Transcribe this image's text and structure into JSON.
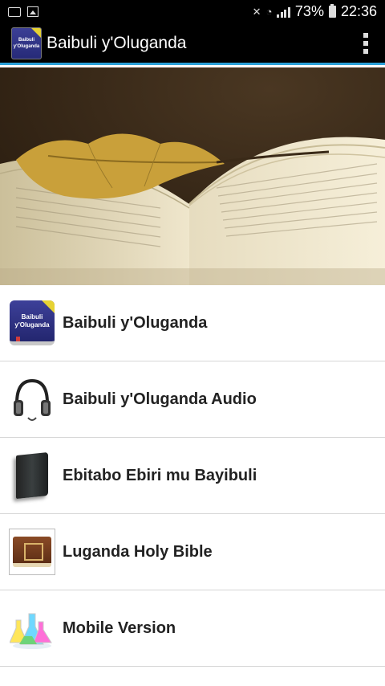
{
  "status_bar": {
    "left_icons": [
      "photo-notification-icon",
      "image-notification-icon"
    ],
    "right_icons": [
      "mute-icon",
      "wifi-icon",
      "signal-icon",
      "battery-icon"
    ],
    "battery": "73%",
    "time": "22:36"
  },
  "action_bar": {
    "app_icon_text_line1": "Baibuli",
    "app_icon_text_line2": "y'Oluganda",
    "title": "Baibuli y'Oluganda",
    "overflow_icon": "more-vert-icon"
  },
  "hero": {
    "image": "open-book-with-autumn-leaf"
  },
  "menu": {
    "items": [
      {
        "label": "Baibuli y'Oluganda",
        "icon": "bible-book-icon",
        "icon_text_line1": "Baibuli",
        "icon_text_line2": "y'Oluganda"
      },
      {
        "label": "Baibuli y'Oluganda Audio",
        "icon": "headphones-icon"
      },
      {
        "label": "Ebitabo Ebiri mu Bayibuli",
        "icon": "dark-book-icon"
      },
      {
        "label": "Luganda Holy Bible",
        "icon": "old-book-icon"
      },
      {
        "label": "Mobile Version",
        "icon": "lab-flasks-icon"
      }
    ]
  },
  "colors": {
    "accent": "#2ba0d8",
    "action_bar": "#000000",
    "icon_purple": "#2f3287",
    "icon_corner": "#e6d233"
  }
}
